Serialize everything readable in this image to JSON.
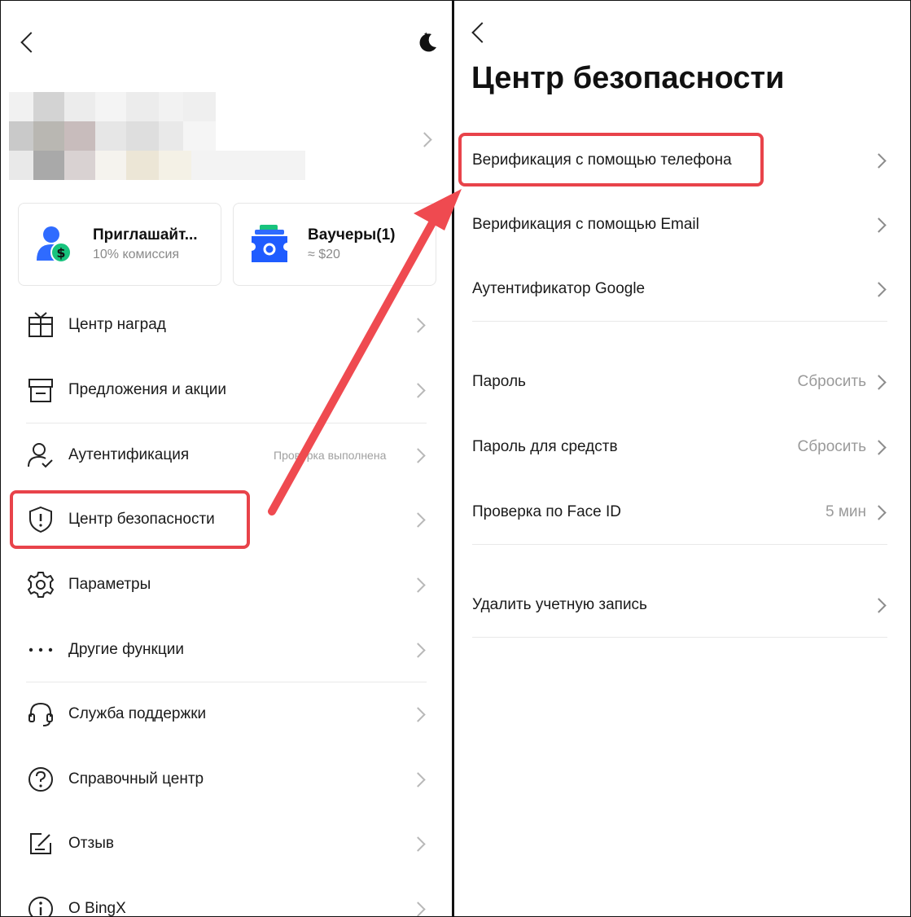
{
  "left": {
    "title_icon": "moon-icon",
    "cards": [
      {
        "title": "Приглашайт...",
        "sub": "10% комиссия",
        "icon": "invite-user-dollar-icon"
      },
      {
        "title": "Ваучеры(1)",
        "sub": "≈ $20",
        "icon": "voucher-ticket-icon"
      }
    ],
    "menu": [
      {
        "label": "Центр наград",
        "icon": "gift-box-icon"
      },
      {
        "label": "Предложения и акции",
        "icon": "store-icon"
      },
      {
        "label": "Аутентификация",
        "icon": "user-check-icon",
        "status": "Проверка выполнена"
      },
      {
        "label": "Центр безопасности",
        "icon": "shield-icon"
      },
      {
        "label": "Параметры",
        "icon": "gear-icon"
      },
      {
        "label": "Другие функции",
        "icon": "more-dots-icon"
      },
      {
        "label": "Служба поддержки",
        "icon": "headset-icon"
      },
      {
        "label": "Справочный центр",
        "icon": "question-circle-icon"
      },
      {
        "label": "Отзыв",
        "icon": "feedback-edit-icon"
      },
      {
        "label": "О BingX",
        "icon": "info-circle-icon"
      }
    ]
  },
  "right": {
    "title": "Центр безопасности",
    "items": [
      {
        "label": "Верификация с помощью телефона"
      },
      {
        "label": "Верификация с помощью Email"
      },
      {
        "label": "Аутентификатор Google"
      },
      {
        "label": "Пароль",
        "value": "Сбросить"
      },
      {
        "label": "Пароль для средств",
        "value": "Сбросить"
      },
      {
        "label": "Проверка по Face ID",
        "value": "5 мин"
      },
      {
        "label": "Удалить учетную запись"
      }
    ]
  },
  "colors": {
    "highlight": "#e8434a",
    "arrow": "#ef4a50",
    "invite_icon_blue": "#2f6bff",
    "invite_icon_green": "#18c37d",
    "voucher_icon_blue": "#1f5cff"
  }
}
